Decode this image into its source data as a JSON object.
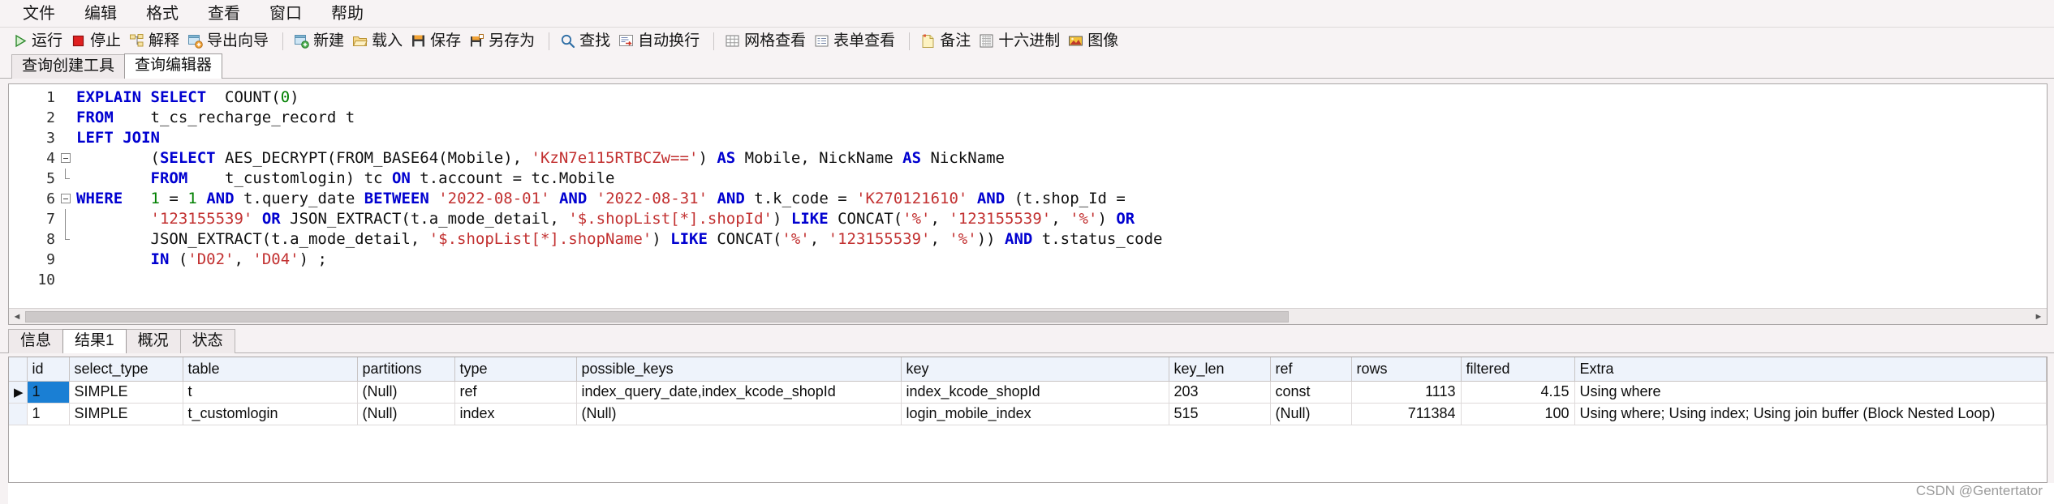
{
  "menu": {
    "items": [
      {
        "label": "文件",
        "name": "menu-file"
      },
      {
        "label": "编辑",
        "name": "menu-edit"
      },
      {
        "label": "格式",
        "name": "menu-format"
      },
      {
        "label": "查看",
        "name": "menu-view"
      },
      {
        "label": "窗口",
        "name": "menu-window"
      },
      {
        "label": "帮助",
        "name": "menu-help"
      }
    ]
  },
  "toolbar": {
    "run": "运行",
    "stop": "停止",
    "explain": "解释",
    "export_wizard": "导出向导",
    "new": "新建",
    "load": "载入",
    "save": "保存",
    "save_as": "另存为",
    "find": "查找",
    "word_wrap": "自动换行",
    "grid_view": "网格查看",
    "form_view": "表单查看",
    "note": "备注",
    "hex": "十六进制",
    "image": "图像"
  },
  "top_tabs": [
    {
      "label": "查询创建工具",
      "active": false
    },
    {
      "label": "查询编辑器",
      "active": true
    }
  ],
  "editor": {
    "lines": [
      {
        "num": "1",
        "fold": "none",
        "tokens": [
          {
            "t": "EXPLAIN SELECT",
            "c": "kw"
          },
          {
            "t": "  ",
            "c": "pln"
          },
          {
            "t": "COUNT",
            "c": "pln"
          },
          {
            "t": "(",
            "c": "pln"
          },
          {
            "t": "0",
            "c": "num"
          },
          {
            "t": ")",
            "c": "pln"
          }
        ]
      },
      {
        "num": "2",
        "fold": "none",
        "tokens": [
          {
            "t": "FROM",
            "c": "kw"
          },
          {
            "t": "    t_cs_recharge_record t",
            "c": "pln"
          }
        ]
      },
      {
        "num": "3",
        "fold": "none",
        "tokens": [
          {
            "t": "LEFT JOIN",
            "c": "kw"
          }
        ]
      },
      {
        "num": "4",
        "fold": "start",
        "tokens": [
          {
            "t": "        (",
            "c": "pln"
          },
          {
            "t": "SELECT",
            "c": "kw"
          },
          {
            "t": " AES_DECRYPT(FROM_BASE64(Mobile), ",
            "c": "pln"
          },
          {
            "t": "'KzN7e115RTBCZw=='",
            "c": "str"
          },
          {
            "t": ") ",
            "c": "pln"
          },
          {
            "t": "AS",
            "c": "kw"
          },
          {
            "t": " Mobile, NickName ",
            "c": "pln"
          },
          {
            "t": "AS",
            "c": "kw"
          },
          {
            "t": " NickName",
            "c": "pln"
          }
        ]
      },
      {
        "num": "5",
        "fold": "end",
        "tokens": [
          {
            "t": "        ",
            "c": "pln"
          },
          {
            "t": "FROM",
            "c": "kw"
          },
          {
            "t": "    t_customlogin) tc ",
            "c": "pln"
          },
          {
            "t": "ON",
            "c": "kw"
          },
          {
            "t": " t.account = tc.Mobile",
            "c": "pln"
          }
        ]
      },
      {
        "num": "6",
        "fold": "start",
        "tokens": [
          {
            "t": "WHERE",
            "c": "kw"
          },
          {
            "t": "   ",
            "c": "pln"
          },
          {
            "t": "1",
            "c": "num"
          },
          {
            "t": " = ",
            "c": "pln"
          },
          {
            "t": "1",
            "c": "num"
          },
          {
            "t": " ",
            "c": "pln"
          },
          {
            "t": "AND",
            "c": "kw"
          },
          {
            "t": " t.query_date ",
            "c": "pln"
          },
          {
            "t": "BETWEEN",
            "c": "kw"
          },
          {
            "t": " ",
            "c": "pln"
          },
          {
            "t": "'2022-08-01'",
            "c": "str"
          },
          {
            "t": " ",
            "c": "pln"
          },
          {
            "t": "AND",
            "c": "kw"
          },
          {
            "t": " ",
            "c": "pln"
          },
          {
            "t": "'2022-08-31'",
            "c": "str"
          },
          {
            "t": " ",
            "c": "pln"
          },
          {
            "t": "AND",
            "c": "kw"
          },
          {
            "t": " t.k_code = ",
            "c": "pln"
          },
          {
            "t": "'K270121610'",
            "c": "str"
          },
          {
            "t": " ",
            "c": "pln"
          },
          {
            "t": "AND",
            "c": "kw"
          },
          {
            "t": " (t.shop_Id =",
            "c": "pln"
          }
        ]
      },
      {
        "num": "7",
        "fold": "mid",
        "tokens": [
          {
            "t": "        ",
            "c": "pln"
          },
          {
            "t": "'123155539'",
            "c": "str"
          },
          {
            "t": " ",
            "c": "pln"
          },
          {
            "t": "OR",
            "c": "kw"
          },
          {
            "t": " JSON_EXTRACT(t.a_mode_detail, ",
            "c": "pln"
          },
          {
            "t": "'$.shopList[*].shopId'",
            "c": "str"
          },
          {
            "t": ") ",
            "c": "pln"
          },
          {
            "t": "LIKE",
            "c": "kw"
          },
          {
            "t": " CONCAT(",
            "c": "pln"
          },
          {
            "t": "'%'",
            "c": "str"
          },
          {
            "t": ", ",
            "c": "pln"
          },
          {
            "t": "'123155539'",
            "c": "str"
          },
          {
            "t": ", ",
            "c": "pln"
          },
          {
            "t": "'%'",
            "c": "str"
          },
          {
            "t": ") ",
            "c": "pln"
          },
          {
            "t": "OR",
            "c": "kw"
          }
        ]
      },
      {
        "num": "8",
        "fold": "end",
        "tokens": [
          {
            "t": "        JSON_EXTRACT(t.a_mode_detail, ",
            "c": "pln"
          },
          {
            "t": "'$.shopList[*].shopName'",
            "c": "str"
          },
          {
            "t": ") ",
            "c": "pln"
          },
          {
            "t": "LIKE",
            "c": "kw"
          },
          {
            "t": " CONCAT(",
            "c": "pln"
          },
          {
            "t": "'%'",
            "c": "str"
          },
          {
            "t": ", ",
            "c": "pln"
          },
          {
            "t": "'123155539'",
            "c": "str"
          },
          {
            "t": ", ",
            "c": "pln"
          },
          {
            "t": "'%'",
            "c": "str"
          },
          {
            "t": ")) ",
            "c": "pln"
          },
          {
            "t": "AND",
            "c": "kw"
          },
          {
            "t": " t.status_code",
            "c": "pln"
          }
        ]
      },
      {
        "num": "9",
        "fold": "none",
        "tokens": [
          {
            "t": "        ",
            "c": "pln"
          },
          {
            "t": "IN",
            "c": "kw"
          },
          {
            "t": " (",
            "c": "pln"
          },
          {
            "t": "'D02'",
            "c": "str"
          },
          {
            "t": ", ",
            "c": "pln"
          },
          {
            "t": "'D04'",
            "c": "str"
          },
          {
            "t": ") ;",
            "c": "pln"
          }
        ]
      },
      {
        "num": "10",
        "fold": "none",
        "tokens": []
      }
    ]
  },
  "bottom_tabs": [
    {
      "label": "信息",
      "active": false
    },
    {
      "label": "结果1",
      "active": true
    },
    {
      "label": "概况",
      "active": false
    },
    {
      "label": "状态",
      "active": false
    }
  ],
  "results": {
    "columns": [
      "id",
      "select_type",
      "table",
      "partitions",
      "type",
      "possible_keys",
      "key",
      "key_len",
      "ref",
      "rows",
      "filtered",
      "Extra"
    ],
    "rows": [
      {
        "marker": "▶",
        "selected_index": 0,
        "cells": [
          "1",
          "SIMPLE",
          "t",
          "(Null)",
          "ref",
          "index_query_date,index_kcode_shopId",
          "index_kcode_shopId",
          "203",
          "const",
          "1113",
          "4.15",
          "Using where"
        ]
      },
      {
        "marker": "",
        "selected_index": -1,
        "cells": [
          "1",
          "SIMPLE",
          "t_customlogin",
          "(Null)",
          "index",
          "(Null)",
          "login_mobile_index",
          "515",
          "(Null)",
          "711384",
          "100",
          "Using where; Using index; Using join buffer (Block Nested Loop)"
        ]
      }
    ]
  },
  "watermark": "CSDN @Gentertator",
  "colors": {
    "accent_selected": "#1a7fd4",
    "header_bg": "#eef3fb",
    "keyword": "#0000d0",
    "string": "#c23030",
    "number": "#008000",
    "chrome": "#f7f3f4"
  }
}
